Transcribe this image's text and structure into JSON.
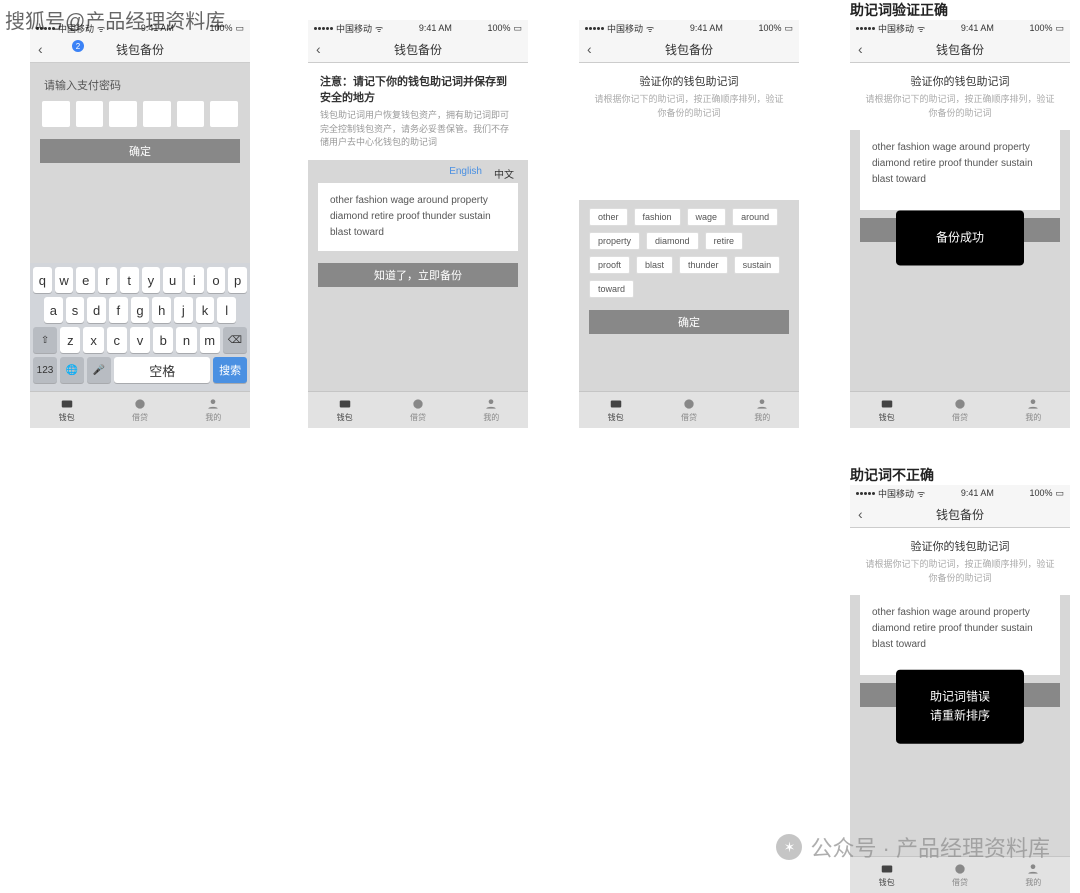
{
  "watermarks": {
    "top_left": "搜狐号@产品经理资料库",
    "bottom_right": "公众号 · 产品经理资料库"
  },
  "statusbar": {
    "carrier": "中国移动",
    "time": "9:41 AM",
    "battery": "100%"
  },
  "nav_title": "钱包备份",
  "badge": "2",
  "tabs": {
    "wallet": "钱包",
    "credit": "借贷",
    "mine": "我的"
  },
  "screen1": {
    "prompt": "请输入支付密码",
    "confirm": "确定",
    "keyboard": {
      "row1": [
        "q",
        "w",
        "e",
        "r",
        "t",
        "y",
        "u",
        "i",
        "o",
        "p"
      ],
      "row2": [
        "a",
        "s",
        "d",
        "f",
        "g",
        "h",
        "j",
        "k",
        "l"
      ],
      "row3_letters": [
        "z",
        "x",
        "c",
        "v",
        "b",
        "n",
        "m"
      ],
      "num": "123",
      "space": "空格",
      "search": "搜索"
    }
  },
  "screen2": {
    "notice_title": "注意：请记下你的钱包助记词并保存到安全的地方",
    "notice_sub": "钱包助记词用户恢复钱包资产，拥有助记词即可完全控制钱包资产，请务必妥善保管。我们不存储用户去中心化钱包的助记词",
    "lang_en": "English",
    "lang_cn": "中文",
    "words": "other   fashion   wage   around  property diamond  retire   proof   thunder  sustain blast   toward",
    "btn": "知道了，立即备份"
  },
  "screen3": {
    "title": "验证你的钱包助记词",
    "sub": "请根据你记下的助记词，按正确顺序排列，验证你备份的助记词",
    "chips": [
      "other",
      "fashion",
      "wage",
      "around",
      "property",
      "diamond",
      "retire",
      "prooft",
      "blast",
      "thunder",
      "sustain",
      "toward"
    ],
    "btn": "确定"
  },
  "screen4": {
    "caption": "助记词验证正确",
    "title": "验证你的钱包助记词",
    "sub": "请根据你记下的助记词，按正确顺序排列，验证你备份的助记词",
    "words": "other   fashion   wage   around  property diamond  retire   proof   thunder  sustain blast   toward",
    "toast": "备份成功"
  },
  "screen5": {
    "caption": "助记词不正确",
    "title": "验证你的钱包助记词",
    "sub": "请根据你记下的助记词，按正确顺序排列，验证你备份的助记词",
    "words": "other   fashion   wage   around  property diamond  retire   proof   thunder  sustain blast   toward",
    "toast": "助记词错误\n请重新排序"
  }
}
